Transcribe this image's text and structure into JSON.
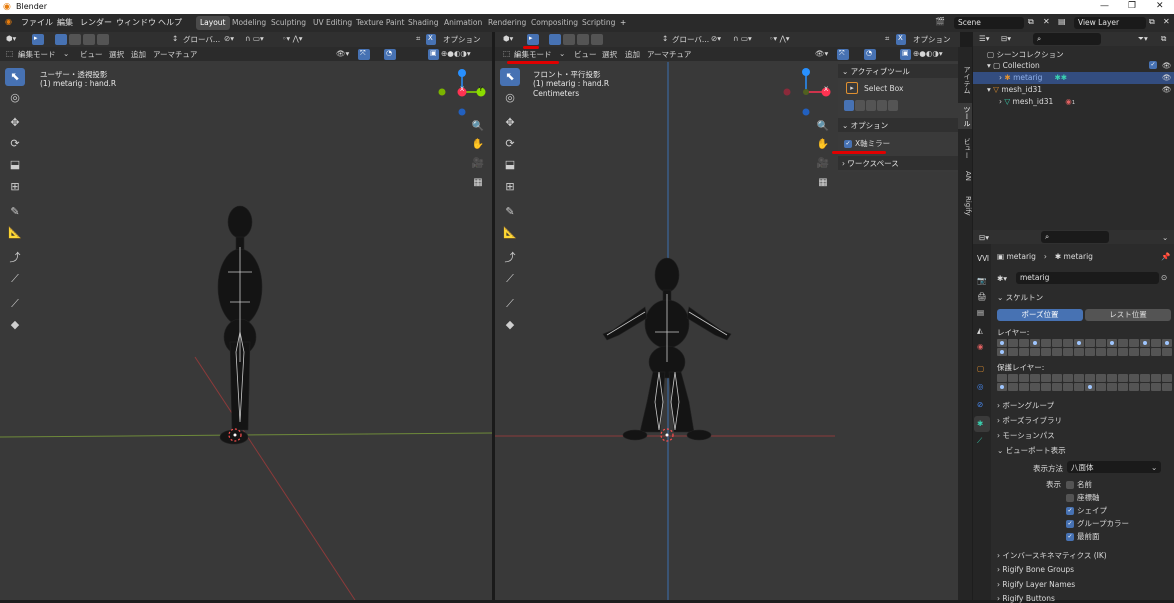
{
  "window": {
    "title": "Blender"
  },
  "menu": {
    "file": "ファイル",
    "edit": "編集",
    "render": "レンダー",
    "window": "ウィンドウ",
    "help": "ヘルプ"
  },
  "workspaces": [
    "Layout",
    "Modeling",
    "Sculpting",
    "UV Editing",
    "Texture Paint",
    "Shading",
    "Animation",
    "Rendering",
    "Compositing",
    "Scripting"
  ],
  "workspace_add": "+",
  "scene": {
    "name": "Scene",
    "view_layer": "View Layer"
  },
  "left_viewport": {
    "orientation": "グローバ...",
    "options": "オプション",
    "mode": "編集モード",
    "menus": [
      "ビュー",
      "選択",
      "追加",
      "アーマチュア"
    ],
    "view_name": "ユーザー・透視投影",
    "object_info": "(1) metarig : hand.R"
  },
  "right_viewport": {
    "orientation": "グローバ...",
    "options": "オプション",
    "mode": "編集モード",
    "menus": [
      "ビュー",
      "選択",
      "追加",
      "アーマチュア"
    ],
    "view_name": "フロント・平行投影",
    "object_info": "(1) metarig : hand.R",
    "units": "Centimeters"
  },
  "npanel": {
    "active_tool_header": "アクティブツール",
    "tool_name": "Select Box",
    "options_header": "オプション",
    "x_mirror": "X軸ミラー",
    "x_mirror_checked": true,
    "workspace_header": "ワークスペース",
    "tabs": [
      "アイテム",
      "ツール",
      "ビュー",
      "AN",
      "Rigify"
    ]
  },
  "gizmo": {
    "x": "X",
    "y": "Y",
    "z": "Z"
  },
  "outliner": {
    "scene_collection": "シーンコレクション",
    "items": [
      {
        "label": "Collection",
        "indent": 1
      },
      {
        "label": "metarig",
        "indent": 2,
        "selected": true
      },
      {
        "label": "mesh_id31",
        "indent": 1
      },
      {
        "label": "mesh_id31",
        "indent": 2
      }
    ],
    "modifier_count": "1"
  },
  "properties": {
    "breadcrumb_object": "metarig",
    "breadcrumb_data": "metarig",
    "datablock_name": "metarig",
    "skeleton_header": "スケルトン",
    "pose_position": "ポーズ位置",
    "rest_position": "レスト位置",
    "layers_label": "レイヤー:",
    "protected_layers_label": "保護レイヤー:",
    "sections": [
      "ボーングループ",
      "ポーズライブラリ",
      "モーションパス",
      "ビューポート表示"
    ],
    "display_as_label": "表示方法",
    "display_as_value": "八面体",
    "show_label": "表示",
    "show_options": [
      {
        "label": "名前",
        "checked": false
      },
      {
        "label": "座標軸",
        "checked": false
      },
      {
        "label": "シェイプ",
        "checked": true
      },
      {
        "label": "グループカラー",
        "checked": true
      },
      {
        "label": "最前面",
        "checked": true
      }
    ],
    "footer_sections": [
      "インバースキネマティクス (IK)",
      "Rigify Bone Groups",
      "Rigify Layer Names",
      "Rigify Buttons"
    ]
  },
  "colors": {
    "accent": "#4772b3",
    "x_axis": "#ff3352",
    "y_axis": "#8bdc00",
    "z_axis": "#2890ff",
    "underline": "#e00000"
  }
}
